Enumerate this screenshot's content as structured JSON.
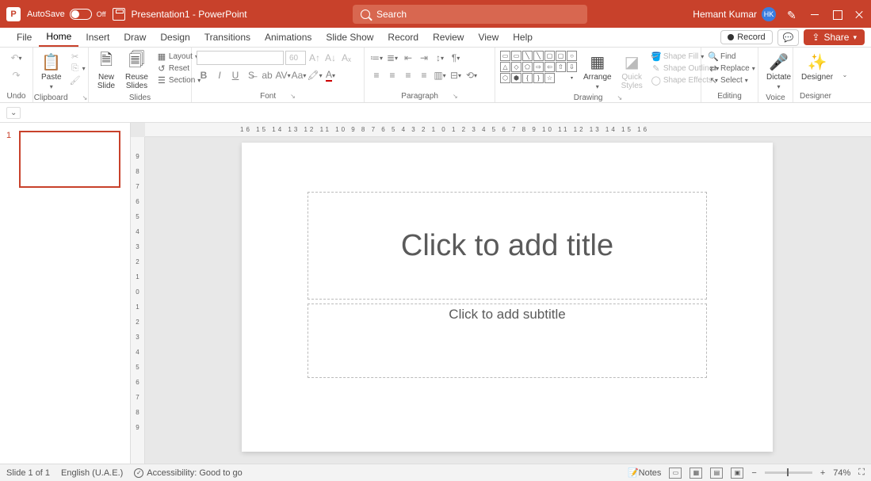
{
  "titlebar": {
    "autosave_label": "AutoSave",
    "autosave_state": "Off",
    "doc_title": "Presentation1 - PowerPoint",
    "search_placeholder": "Search",
    "user_name": "Hemant Kumar",
    "user_initials": "HK"
  },
  "menu": {
    "tabs": [
      "File",
      "Home",
      "Insert",
      "Draw",
      "Design",
      "Transitions",
      "Animations",
      "Slide Show",
      "Record",
      "Review",
      "View",
      "Help"
    ],
    "active_index": 1,
    "record_btn": "Record",
    "share_btn": "Share"
  },
  "ribbon": {
    "undo": {
      "label": "Undo"
    },
    "clipboard": {
      "paste": "Paste",
      "label": "Clipboard"
    },
    "slides": {
      "new": "New\nSlide",
      "reuse": "Reuse\nSlides",
      "layout": "Layout",
      "reset": "Reset",
      "section": "Section",
      "label": "Slides"
    },
    "font": {
      "name_value": "",
      "size_value": "60",
      "label": "Font"
    },
    "paragraph": {
      "label": "Paragraph"
    },
    "drawing": {
      "arrange": "Arrange",
      "quick": "Quick\nStyles",
      "fill": "Shape Fill",
      "outline": "Shape Outline",
      "effects": "Shape Effects",
      "label": "Drawing"
    },
    "editing": {
      "find": "Find",
      "replace": "Replace",
      "select": "Select",
      "label": "Editing"
    },
    "voice": {
      "dictate": "Dictate",
      "label": "Voice"
    },
    "designer": {
      "designer": "Designer",
      "label": "Designer"
    }
  },
  "slide": {
    "title_placeholder": "Click to add title",
    "subtitle_placeholder": "Click to add subtitle",
    "thumb_number": "1"
  },
  "ruler": {
    "h": "16  15  14  13  12  11  10  9  8  7  6  5  4  3  2  1  0  1  2  3  4  5  6  7  8  9  10  11  12  13  14  15  16",
    "v": [
      "9",
      "8",
      "7",
      "6",
      "5",
      "4",
      "3",
      "2",
      "1",
      "0",
      "1",
      "2",
      "3",
      "4",
      "5",
      "6",
      "7",
      "8",
      "9"
    ]
  },
  "status": {
    "slide": "Slide 1 of 1",
    "lang": "English (U.A.E.)",
    "accessibility": "Accessibility: Good to go",
    "notes": "Notes",
    "zoom": "74%"
  }
}
